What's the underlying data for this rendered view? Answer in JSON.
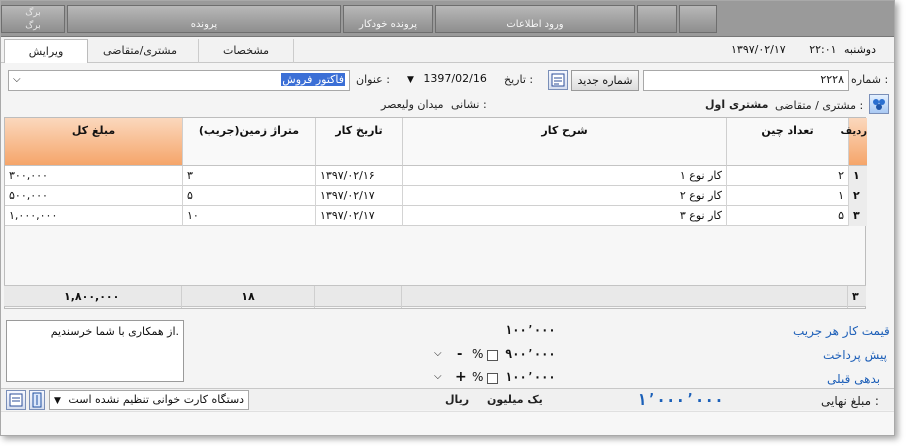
{
  "ribbon": {
    "tabs": [
      "ورود اطلاعات",
      "پرونده خودکار",
      "پرونده"
    ],
    "leftTabTop": "برگ",
    "leftTabBottom": "برگ"
  },
  "tabs": {
    "edit": "ویرایش",
    "customer": "مشتری/متقاضی",
    "specs": "مشخصات"
  },
  "datetime": {
    "time": "۲۲:۰۱",
    "day": "دوشنبه",
    "date": "۱۳۹۷/۰۲/۱۷"
  },
  "form": {
    "number_label": "شماره :",
    "number_value": "۲۲۲۸",
    "new_number_button": "شماره جدید",
    "date_label": "تاریخ :",
    "date_value": "1397/02/16",
    "title_label": "عنوان :",
    "title_value": "فاکتور فروش",
    "customer_label": "مشتری / متقاضی :",
    "customer_value": "مشتری اول",
    "address_label": "نشانی :",
    "address_value": "میدان ولیعصر"
  },
  "grid": {
    "headers": {
      "row": "ردیف",
      "count": "تعداد چین",
      "desc": "شرح کار",
      "date": "تاریخ کار",
      "area": "متراژ زمین(جریب)",
      "total": "مبلغ کل"
    },
    "rows": [
      {
        "idx": "۱",
        "count": "۲",
        "desc": "کار نوع ۱",
        "date": "۱۳۹۷/۰۲/۱۶",
        "area": "۳",
        "total": "۳۰۰,۰۰۰"
      },
      {
        "idx": "۲",
        "count": "۱",
        "desc": "کار نوع ۲",
        "date": "۱۳۹۷/۰۲/۱۷",
        "area": "۵",
        "total": "۵۰۰,۰۰۰"
      },
      {
        "idx": "۳",
        "count": "۵",
        "desc": "کار نوع ۳",
        "date": "۱۳۹۷/۰۲/۱۷",
        "area": "۱۰",
        "total": "۱,۰۰۰,۰۰۰"
      }
    ],
    "totals": {
      "rows": "۳",
      "area": "۱۸",
      "total": "۱,۸۰۰,۰۰۰"
    }
  },
  "summary": {
    "price_label": "قیمت کار هر جریب",
    "price_value": "۱۰۰٬۰۰۰",
    "prepay_label": "پیش پرداخت",
    "prepay_value": "۹۰۰٬۰۰۰",
    "prepay_sign": "-",
    "percent_sign": "%",
    "prevdebt_label": "بدهی قبلی",
    "prevdebt_value": "۱۰۰٬۰۰۰",
    "prevdebt_sign": "+",
    "final_label": "مبلغ نهایی :",
    "final_value": "۱٬۰۰۰٬۰۰۰",
    "final_words": "یک میلیون",
    "currency": "ریال"
  },
  "memo": {
    "text": "از همکاری با شما خرسندیم."
  },
  "status": {
    "card_reader": "دستگاه کارت خوانی تنظیم نشده است"
  }
}
